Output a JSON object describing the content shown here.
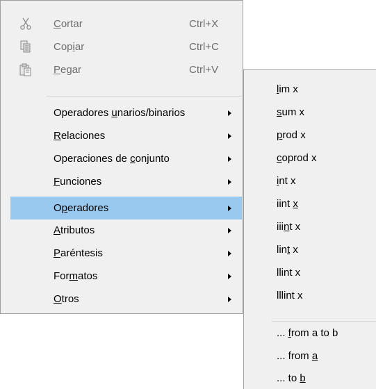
{
  "main_menu": {
    "items": [
      {
        "pre": "",
        "key": "C",
        "post": "ortar",
        "shortcut": "Ctrl+X",
        "icon": "scissors-icon",
        "disabled": true
      },
      {
        "pre": "Cop",
        "key": "i",
        "post": "ar",
        "shortcut": "Ctrl+C",
        "icon": "copy-icon",
        "disabled": true
      },
      {
        "pre": "",
        "key": "P",
        "post": "egar",
        "shortcut": "Ctrl+V",
        "icon": "paste-icon",
        "disabled": true
      },
      {
        "pre": "Operadores ",
        "key": "u",
        "post": "narios/binarios",
        "submenu": true
      },
      {
        "pre": "",
        "key": "R",
        "post": "elaciones",
        "submenu": true
      },
      {
        "pre": "Operaciones de ",
        "key": "c",
        "post": "onjunto",
        "submenu": true
      },
      {
        "pre": "",
        "key": "F",
        "post": "unciones",
        "submenu": true
      },
      {
        "pre": "O",
        "key": "p",
        "post": "eradores",
        "submenu": true,
        "highlighted": true
      },
      {
        "pre": "",
        "key": "A",
        "post": "tributos",
        "submenu": true
      },
      {
        "pre": "",
        "key": "P",
        "post": "aréntesis",
        "submenu": true
      },
      {
        "pre": "For",
        "key": "m",
        "post": "atos",
        "submenu": true
      },
      {
        "pre": "",
        "key": "O",
        "post": "tros",
        "submenu": true
      }
    ]
  },
  "submenu": {
    "items": [
      {
        "pre": "",
        "key": "l",
        "post": "im x"
      },
      {
        "pre": "",
        "key": "s",
        "post": "um x"
      },
      {
        "pre": "",
        "key": "p",
        "post": "rod x"
      },
      {
        "pre": "",
        "key": "c",
        "post": "oprod x"
      },
      {
        "pre": "",
        "key": "i",
        "post": "nt x"
      },
      {
        "pre": "iint ",
        "key": "x",
        "post": ""
      },
      {
        "pre": "iii",
        "key": "n",
        "post": "t x"
      },
      {
        "pre": "lin",
        "key": "t",
        "post": " x"
      },
      {
        "pre": "llint x",
        "key": "",
        "post": ""
      },
      {
        "pre": "lllint x",
        "key": "",
        "post": ""
      },
      {
        "pre": "... ",
        "key": "f",
        "post": "rom a to b"
      },
      {
        "pre": "... from ",
        "key": "a",
        "post": ""
      },
      {
        "pre": "... to ",
        "key": "b",
        "post": ""
      }
    ]
  },
  "colors": {
    "menu_bg": "#f0f0f0",
    "highlight": "#99c9ef",
    "disabled_text": "#6d6d6d",
    "border": "#a0a0a0"
  }
}
